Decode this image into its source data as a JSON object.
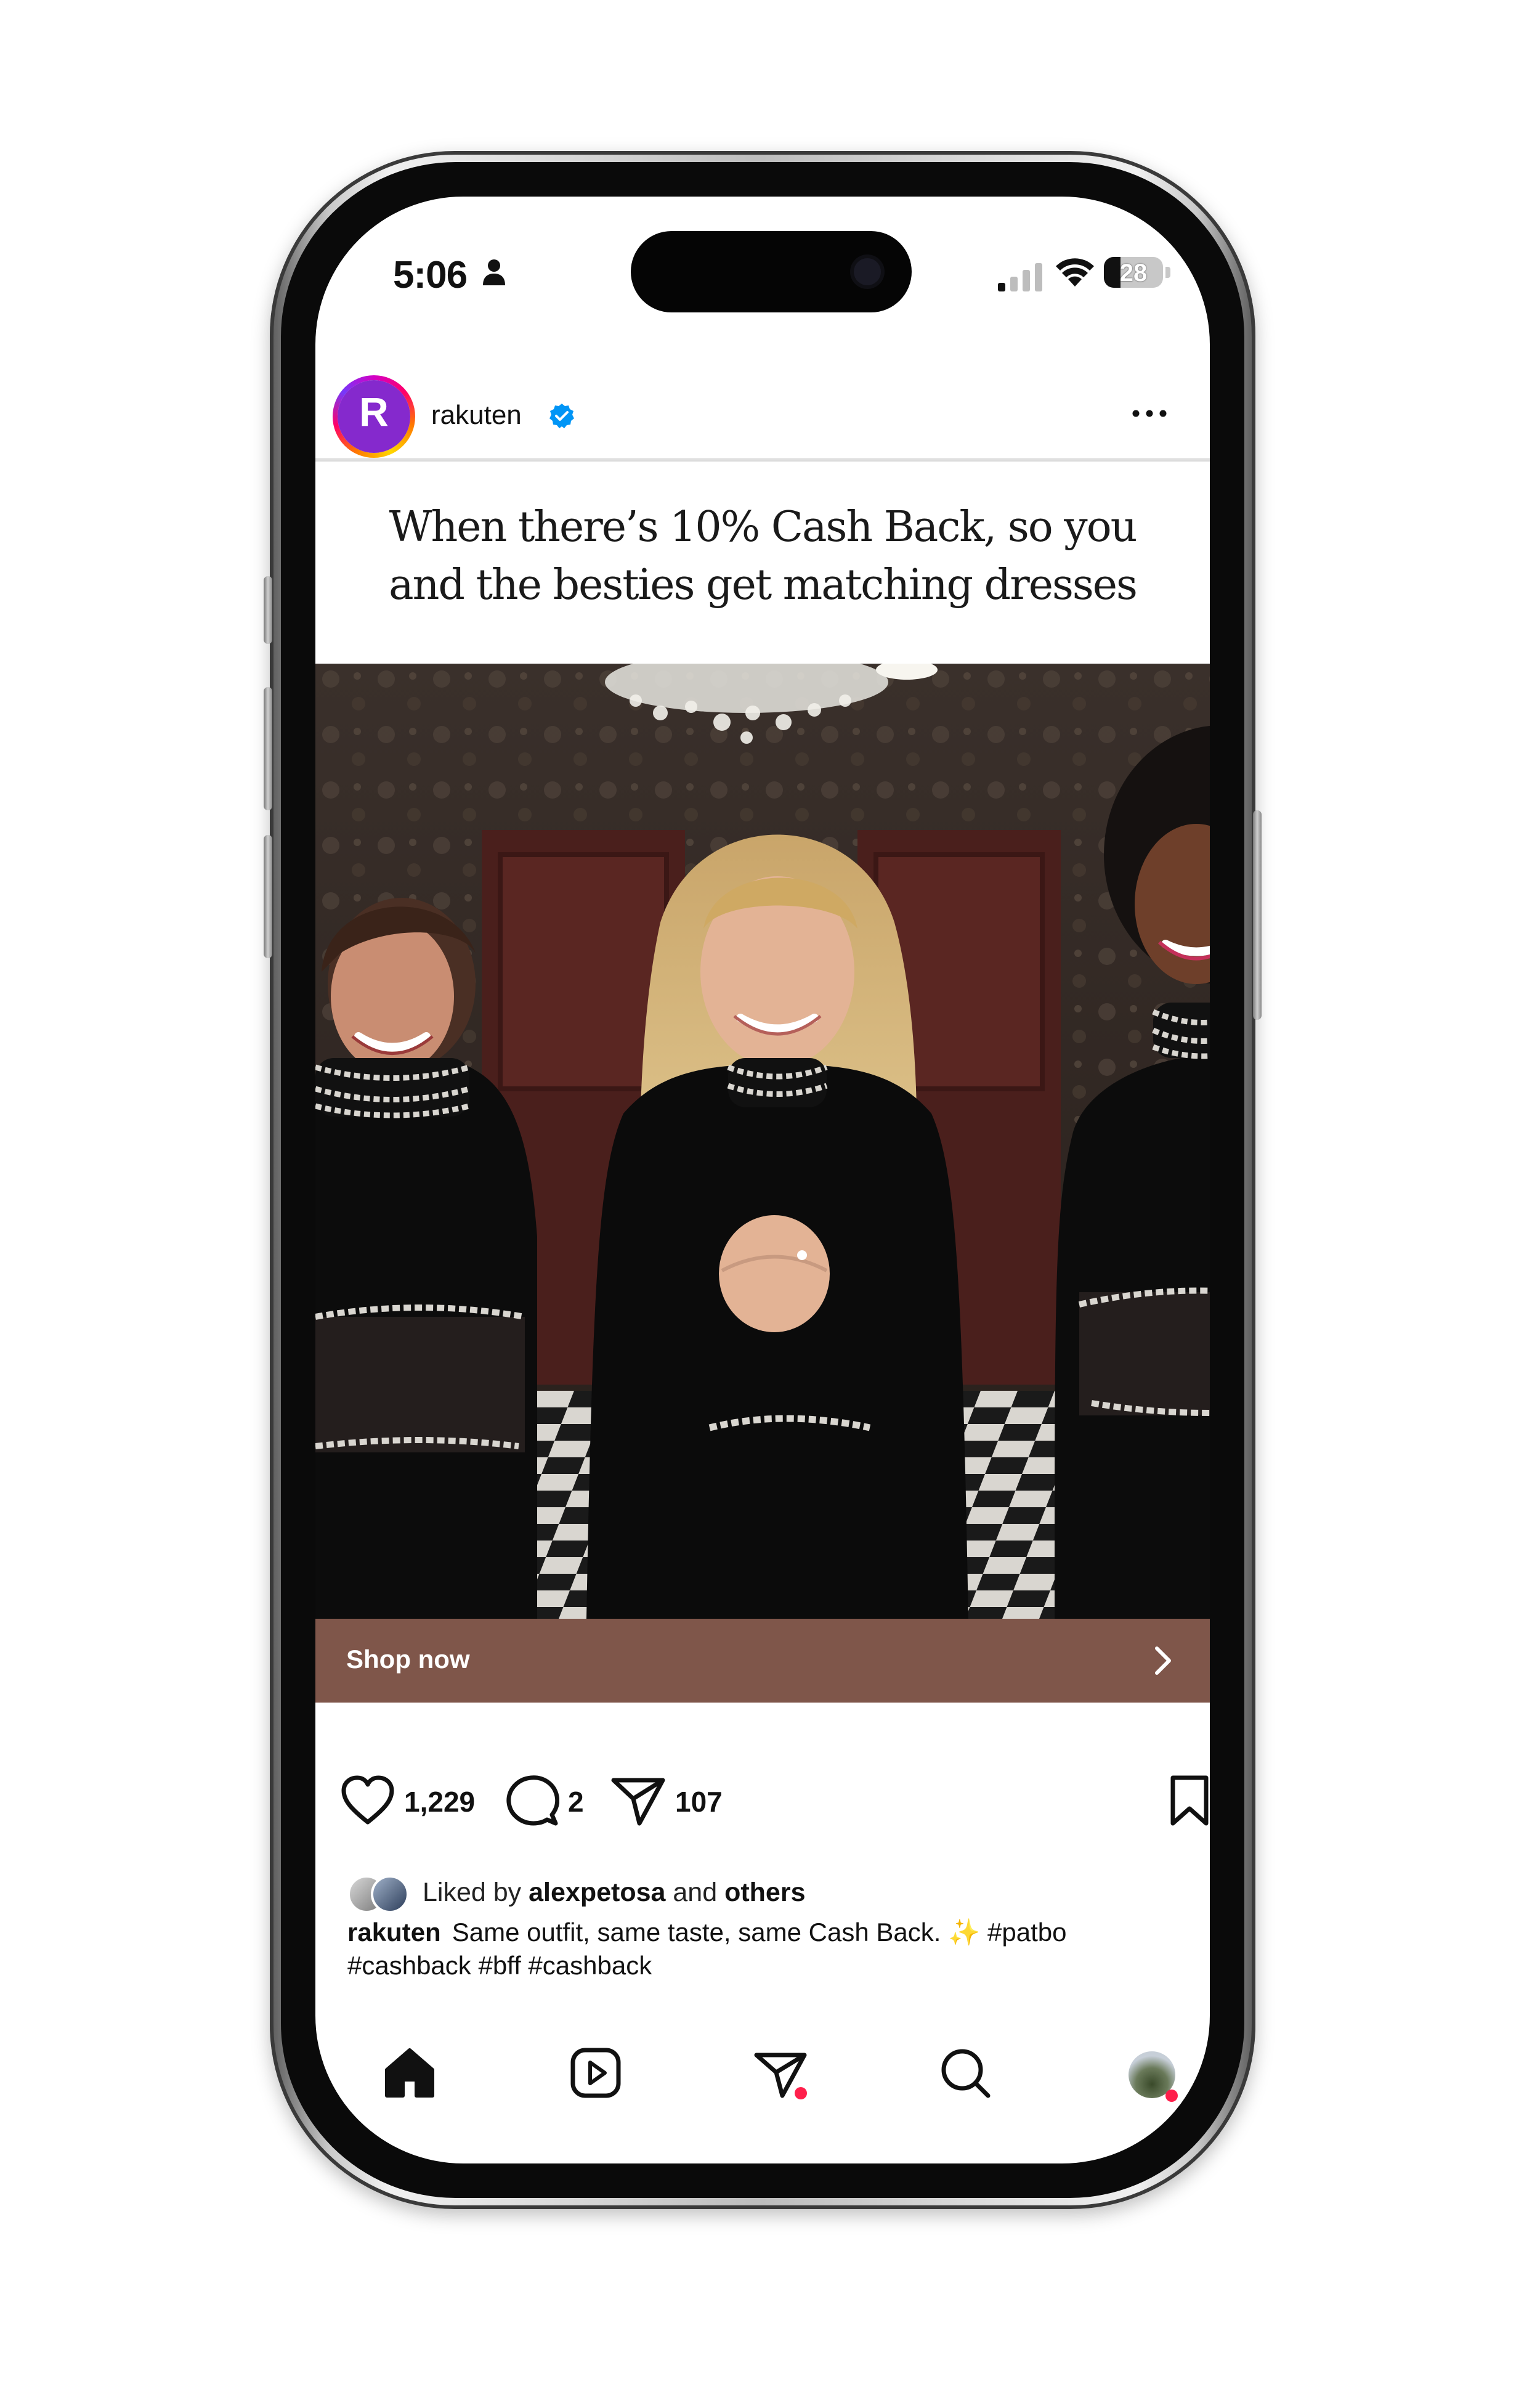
{
  "status_bar": {
    "time": "5:06",
    "battery_level": "28",
    "icons": [
      "person-icon",
      "signal-icon",
      "wifi-icon",
      "battery-icon"
    ]
  },
  "post": {
    "username": "rakuten",
    "verified": true,
    "avatar_letter": "R",
    "headline_line1": "When there’s 10% Cash Back, so you",
    "headline_line2": "and the besties get matching dresses",
    "cta_label": "Shop now",
    "likes_count": "1,229",
    "comments_count": "2",
    "shares_count": "107",
    "liked_by_prefix": "Liked by",
    "liked_by_user": "alexpetosa",
    "liked_by_and": "and",
    "liked_by_others": "others",
    "caption_user": "rakuten",
    "caption_line1": "Same outfit, same taste, same Cash Back. ✨ #patbo",
    "caption_line2": "#cashback #bff #cashback"
  },
  "bottom_nav": {
    "items": [
      "home-icon",
      "reels-icon",
      "messages-icon",
      "search-icon",
      "profile-avatar"
    ]
  },
  "colors": {
    "brand_purple": "#8529cd",
    "cta_brown": "#7f564a",
    "verified_blue": "#0095f6",
    "notification_red": "#ff1f4b"
  }
}
